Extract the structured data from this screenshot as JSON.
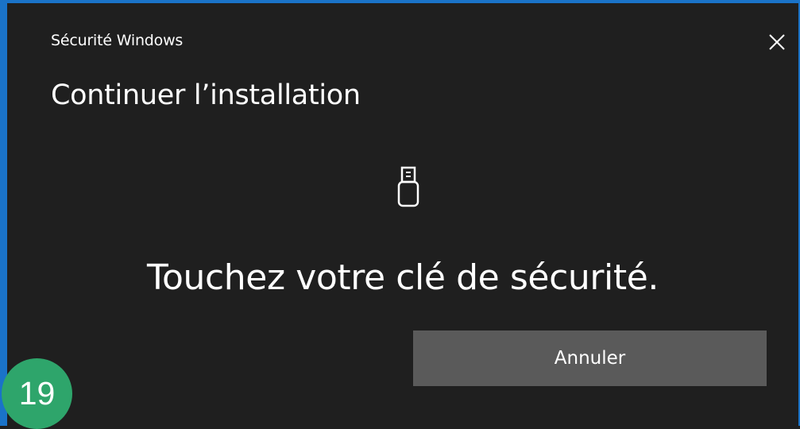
{
  "window": {
    "title": "Sécurité Windows",
    "close_icon": "close-icon"
  },
  "dialog": {
    "heading": "Continuer l’installation",
    "icon": "usb-key-icon",
    "prompt": "Touchez votre clé de sécurité.",
    "cancel_label": "Annuler"
  },
  "overlay": {
    "step_number": "19"
  },
  "colors": {
    "background": "#1f1f1f",
    "accent_border": "#1a73c8",
    "button": "#5a5a5a",
    "badge": "#2ea56b"
  }
}
